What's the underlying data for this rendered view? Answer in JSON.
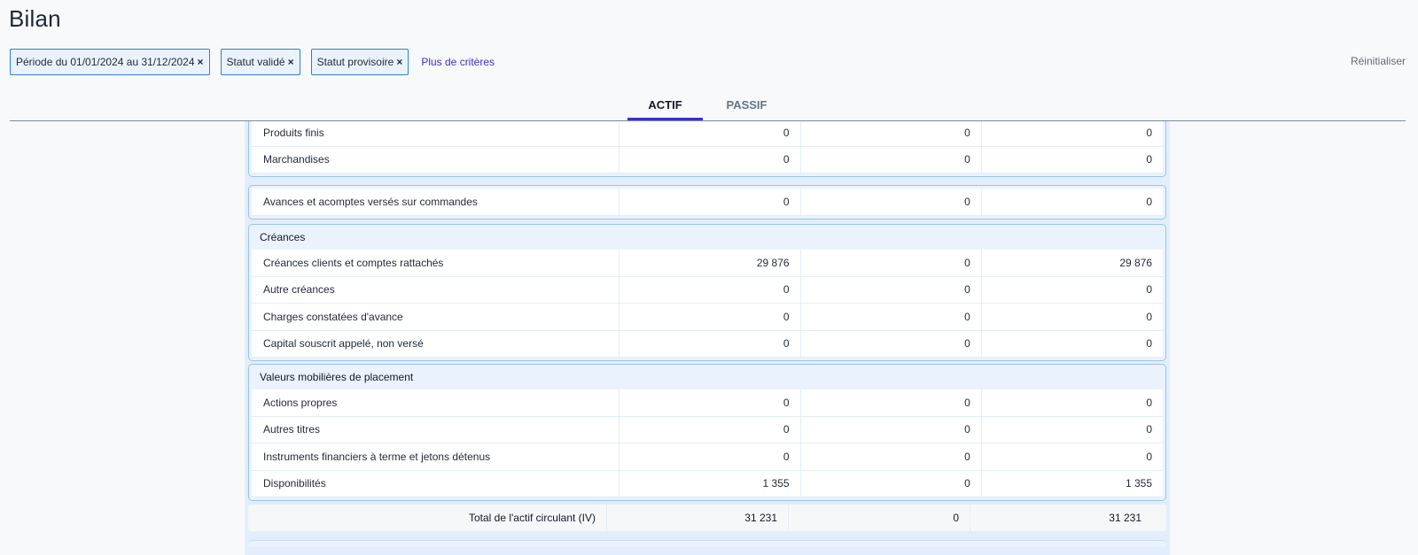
{
  "page": {
    "title": "Bilan"
  },
  "filters": {
    "chips": [
      {
        "label": "Période du 01/01/2024 au 31/12/2024",
        "close": "×"
      },
      {
        "label": "Statut validé",
        "close": "×"
      },
      {
        "label": "Statut provisoire",
        "close": "×"
      }
    ],
    "more_label": "Plus de critères",
    "reset_label": "Réinitialiser"
  },
  "tabs": [
    {
      "label": "ACTIF",
      "active": true
    },
    {
      "label": "PASSIF",
      "active": false
    }
  ],
  "groups": [
    {
      "title": "",
      "rows": [
        {
          "label": "Produits finis",
          "values": [
            "0",
            "0",
            "0"
          ]
        },
        {
          "label": "Marchandises",
          "values": [
            "0",
            "0",
            "0"
          ]
        }
      ]
    },
    {
      "title": "",
      "rows": [
        {
          "label": "Avances et acomptes versés sur commandes",
          "values": [
            "0",
            "0",
            "0"
          ]
        }
      ]
    },
    {
      "title": "Créances",
      "rows": [
        {
          "label": "Créances clients et comptes rattachés",
          "values": [
            "29 876",
            "0",
            "29 876"
          ]
        },
        {
          "label": "Autre créances",
          "values": [
            "0",
            "0",
            "0"
          ]
        },
        {
          "label": "Charges constatées d'avance",
          "values": [
            "0",
            "0",
            "0"
          ]
        },
        {
          "label": "Capital souscrit appelé, non versé",
          "values": [
            "0",
            "0",
            "0"
          ]
        }
      ]
    },
    {
      "title": "Valeurs mobilières de placement",
      "rows": [
        {
          "label": "Actions propres",
          "values": [
            "0",
            "0",
            "0"
          ]
        },
        {
          "label": "Autres titres",
          "values": [
            "0",
            "0",
            "0"
          ]
        },
        {
          "label": "Instruments financiers à terme et jetons détenus",
          "values": [
            "0",
            "0",
            "0"
          ]
        },
        {
          "label": "Disponibilités",
          "values": [
            "1 355",
            "0",
            "1 355"
          ]
        }
      ]
    }
  ],
  "total": {
    "label": "Total de l'actif circulant (IV)",
    "values": [
      "31 231",
      "0",
      "31 231"
    ]
  },
  "colors": {
    "accent": "#3b2fd1",
    "chip_border": "#2d7fd3",
    "chip_bg": "#eaf3fd",
    "group_bg": "#eaf3fd"
  }
}
